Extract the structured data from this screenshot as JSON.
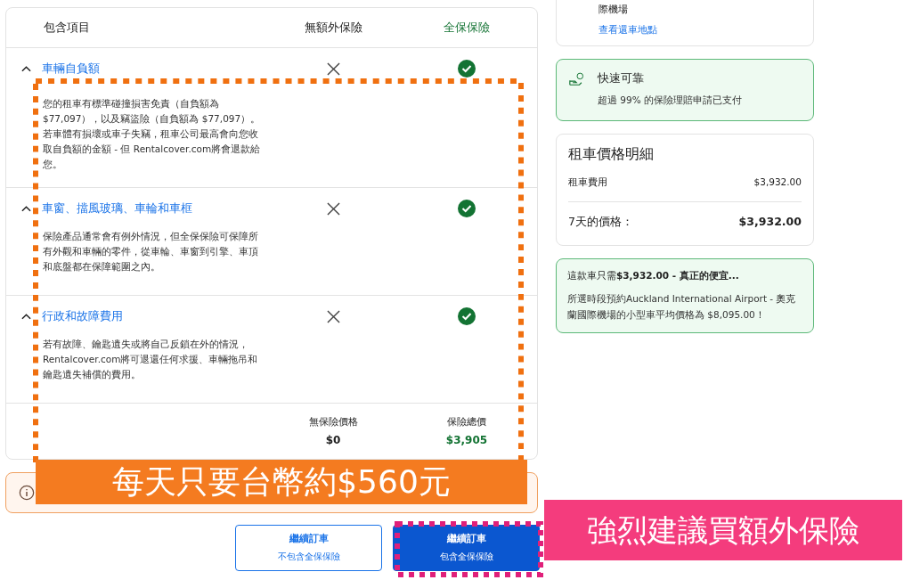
{
  "table": {
    "columns": [
      "包含項目",
      "無額外保險",
      "全保保險"
    ],
    "rows": [
      {
        "title": "車輛自負額",
        "expanded": true,
        "description": "您的租車有標準碰撞損害免責（自負額為 $77,097），以及竊盜險（自負額為 $77,097）。若車體有損壞或車子失竊，租車公司最高會向您收取自負額的金額 - 但 Rentalcover.com將會退款給您。",
        "basic": false,
        "full": true
      },
      {
        "title": "車窗、擋風玻璃、車輪和車框",
        "expanded": true,
        "description": "保險產品通常會有例外情況，但全保保險可保障所有外觀和車輛的零件，從車輪、車窗到引擎、車頂和底盤都在保障範圍之內。",
        "basic": false,
        "full": true
      },
      {
        "title": "行政和故障費用",
        "expanded": true,
        "description": "若有故障、鑰匙遺失或將自己反鎖在外的情況，Rentalcover.com將可退還任何求援、車輛拖吊和鑰匙遺失補償的費用。",
        "basic": false,
        "full": true
      }
    ],
    "totals": [
      {
        "label": "無保險價格",
        "value": "$0"
      },
      {
        "label": "保險總價",
        "value": "$3,905"
      }
    ]
  },
  "buttons": [
    {
      "title": "繼續訂車",
      "subtitle": "不包含全保保險",
      "selected": false
    },
    {
      "title": "繼續訂車",
      "subtitle": "包含全保保險",
      "selected": true
    }
  ],
  "sidebar": {
    "location_card": {
      "text": "際機場",
      "link": "查看還車地點"
    },
    "trust_card": {
      "title": "快速可靠",
      "text": "超過 99% 的保險理賠申請已支付"
    },
    "price_card": {
      "title": "租車價格明細",
      "lines": [
        {
          "label": "租車費用",
          "value": "$3,932.00"
        }
      ],
      "total": {
        "label": "7天的價格：",
        "value": "$3,932.00"
      }
    },
    "deal_card": {
      "title": "這款車只需**$3,932.00 - 真正的便宜...**",
      "text": "所選時段預約Auckland International Airport - 奧克蘭國際機場的小型車平均價格為 $8,095.00！"
    }
  },
  "annotations": [
    {
      "kind": "banner",
      "text": "每天只要台幣約$560元"
    },
    {
      "kind": "label",
      "text": "強烈建議買額外保險"
    }
  ]
}
